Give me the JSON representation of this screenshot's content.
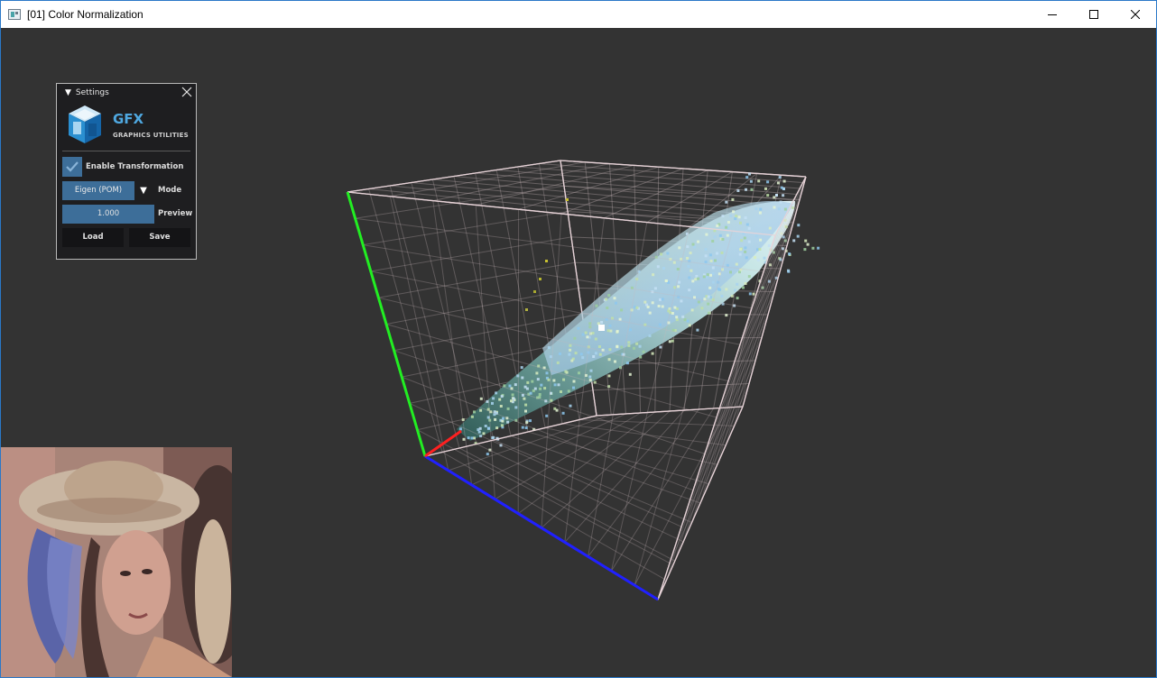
{
  "window": {
    "title": "[01] Color Normalization",
    "controls": [
      "minimize",
      "maximize",
      "close"
    ]
  },
  "settings": {
    "header": "Settings",
    "logo": {
      "title": "GFX",
      "subtitle": "GRAPHICS UTILITIES"
    },
    "enable_transformation": {
      "label": "Enable Transformation",
      "checked": true
    },
    "mode": {
      "value": "Eigen (POM)",
      "label": "Mode"
    },
    "preview": {
      "value": "1.000",
      "label": "Preview"
    },
    "buttons": {
      "load": "Load",
      "save": "Save"
    }
  },
  "viewport": {
    "background": "#333333",
    "axes": {
      "x_color": "#ff2020",
      "y_color": "#22ee22",
      "z_color": "#2020ff"
    },
    "accent": "#3d6e99"
  },
  "thumbnail": {
    "icon": "image-preview"
  }
}
